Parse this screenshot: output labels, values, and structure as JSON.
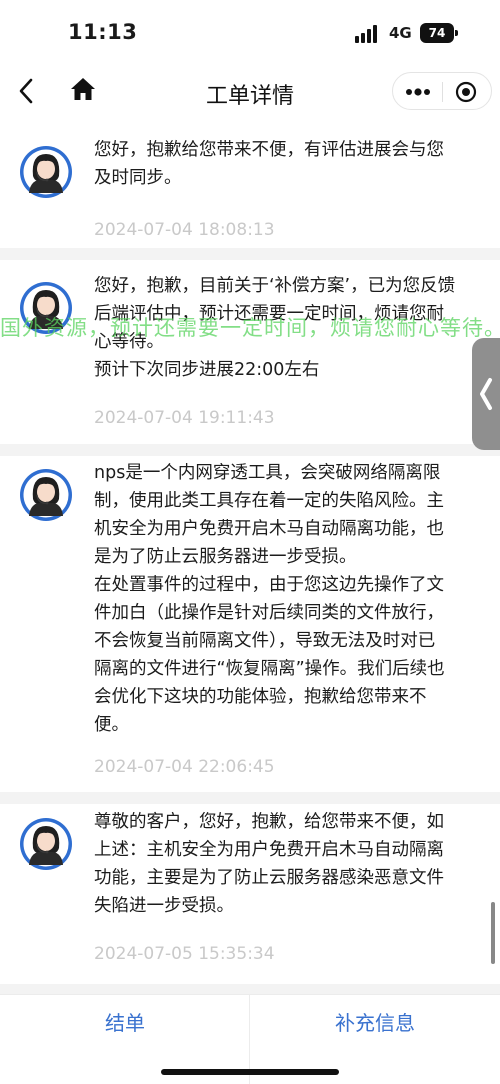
{
  "status_bar": {
    "time": "11:13",
    "network": "4G",
    "battery": "74"
  },
  "nav": {
    "title": "工单详情"
  },
  "watermark": "国外资源，预计还需要一定时间，烦请您耐心等待。",
  "messages": [
    {
      "text": "您好，抱歉给您带来不便，有评估进展会与您\n及时同步。",
      "time": "2024-07-04 18:08:13"
    },
    {
      "text": "您好，抱歉，目前关于‘补偿方案’，已为您反馈\n后端评估中，预计还需要一定时间，烦请您耐\n心等待。\n预计下次同步进展22:00左右",
      "time": "2024-07-04 19:11:43"
    },
    {
      "text": "nps是一个内网穿透工具，会突破网络隔离限\n制，使用此类工具存在着一定的失陷风险。主\n机安全为用户免费开启木马自动隔离功能，也\n是为了防止云服务器进一步受损。\n在处置事件的过程中，由于您这边先操作了文\n件加白（此操作是针对后续同类的文件放行，\n不会恢复当前隔离文件），导致无法及时对已\n隔离的文件进行“恢复隔离”操作。我们后续也\n会优化下这块的功能体验，抱歉给您带来不\n便。",
      "time": "2024-07-04 22:06:45"
    },
    {
      "text": "尊敬的客户，您好，抱歉，给您带来不便，如\n上述：主机安全为用户免费开启木马自动隔离\n功能，主要是为了防止云服务器感染恶意文件\n失陷进一步受损。",
      "time": "2024-07-05 15:35:34"
    }
  ],
  "bottom_bar": {
    "close_ticket": "结单",
    "add_info": "补充信息"
  },
  "colors": {
    "accent": "#3a72cf",
    "timestamp": "#c9c9c9",
    "separator": "#f3f3f3",
    "watermark": "#5ad45f"
  }
}
